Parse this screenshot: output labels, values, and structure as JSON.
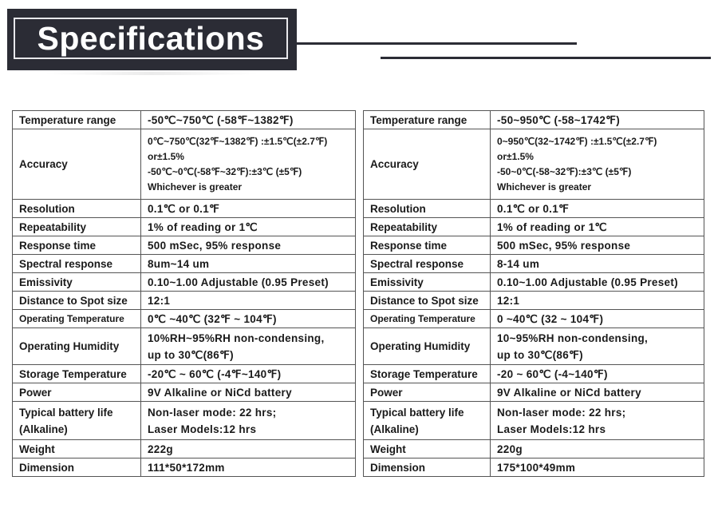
{
  "header": {
    "title": "Specifications"
  },
  "tables": [
    {
      "rows": [
        {
          "label": "Temperature range",
          "value": [
            "-50℃~750℃ (-58℉~1382℉)"
          ]
        },
        {
          "label": "Accuracy",
          "value": [
            "0℃~750℃(32℉~1382℉) :±1.5℃(±2.7℉)",
            "or±1.5%",
            "-50℃~0℃(-58℉~32℉):±3℃ (±5℉)",
            "Whichever is greater"
          ]
        },
        {
          "label": "Resolution",
          "value": [
            "0.1℃ or 0.1℉"
          ]
        },
        {
          "label": "Repeatability",
          "value": [
            "1% of reading or 1℃"
          ]
        },
        {
          "label": "Response time",
          "value": [
            "500 mSec, 95% response"
          ]
        },
        {
          "label": "Spectral response",
          "value": [
            "8um~14 um"
          ]
        },
        {
          "label": "Emissivity",
          "value": [
            "0.10~1.00 Adjustable (0.95 Preset)"
          ]
        },
        {
          "label": "Distance to Spot size",
          "value": [
            "12:1"
          ]
        },
        {
          "label": "Operating Temperature",
          "value": [
            "0℃ ~40℃ (32℉ ~ 104℉)"
          ]
        },
        {
          "label": "Operating Humidity",
          "value": [
            "10%RH~95%RH non-condensing,",
            "up to 30℃(86℉)"
          ]
        },
        {
          "label": "Storage Temperature",
          "value": [
            "-20℃ ~ 60℃ (-4℉~140℉)"
          ]
        },
        {
          "label": "Power",
          "value": [
            "9V Alkaline or NiCd battery"
          ]
        },
        {
          "label": [
            "Typical battery life",
            "(Alkaline)"
          ],
          "value": [
            "Non-laser mode: 22 hrs;",
            "Laser Models:12 hrs"
          ]
        },
        {
          "label": "Weight",
          "value": [
            "222g"
          ]
        },
        {
          "label": "Dimension",
          "value": [
            "111*50*172mm"
          ]
        }
      ]
    },
    {
      "rows": [
        {
          "label": "Temperature range",
          "value": [
            "-50~950℃ (-58~1742℉)"
          ]
        },
        {
          "label": "Accuracy",
          "value": [
            "0~950℃(32~1742℉) :±1.5℃(±2.7℉)",
            "or±1.5%",
            "-50~0℃(-58~32℉):±3℃ (±5℉)",
            "Whichever is greater"
          ]
        },
        {
          "label": "Resolution",
          "value": [
            "0.1℃ or 0.1℉"
          ]
        },
        {
          "label": "Repeatability",
          "value": [
            "1% of reading or 1℃"
          ]
        },
        {
          "label": "Response time",
          "value": [
            "500 mSec, 95% response"
          ]
        },
        {
          "label": "Spectral response",
          "value": [
            "8-14 um"
          ]
        },
        {
          "label": "Emissivity",
          "value": [
            "0.10~1.00 Adjustable (0.95 Preset)"
          ]
        },
        {
          "label": "Distance to Spot size",
          "value": [
            "12:1"
          ]
        },
        {
          "label": "Operating Temperature",
          "value": [
            "0 ~40℃ (32 ~ 104℉)"
          ]
        },
        {
          "label": "Operating Humidity",
          "value": [
            "10~95%RH non-condensing,",
            "up to 30℃(86℉)"
          ]
        },
        {
          "label": "Storage Temperature",
          "value": [
            "-20 ~ 60℃ (-4~140℉)"
          ]
        },
        {
          "label": "Power",
          "value": [
            "9V Alkaline or NiCd battery"
          ]
        },
        {
          "label": [
            "Typical battery life",
            "(Alkaline)"
          ],
          "value": [
            "Non-laser mode: 22 hrs;",
            "Laser Models:12 hrs"
          ]
        },
        {
          "label": "Weight",
          "value": [
            "220g"
          ]
        },
        {
          "label": "Dimension",
          "value": [
            "175*100*49mm"
          ]
        }
      ]
    }
  ]
}
